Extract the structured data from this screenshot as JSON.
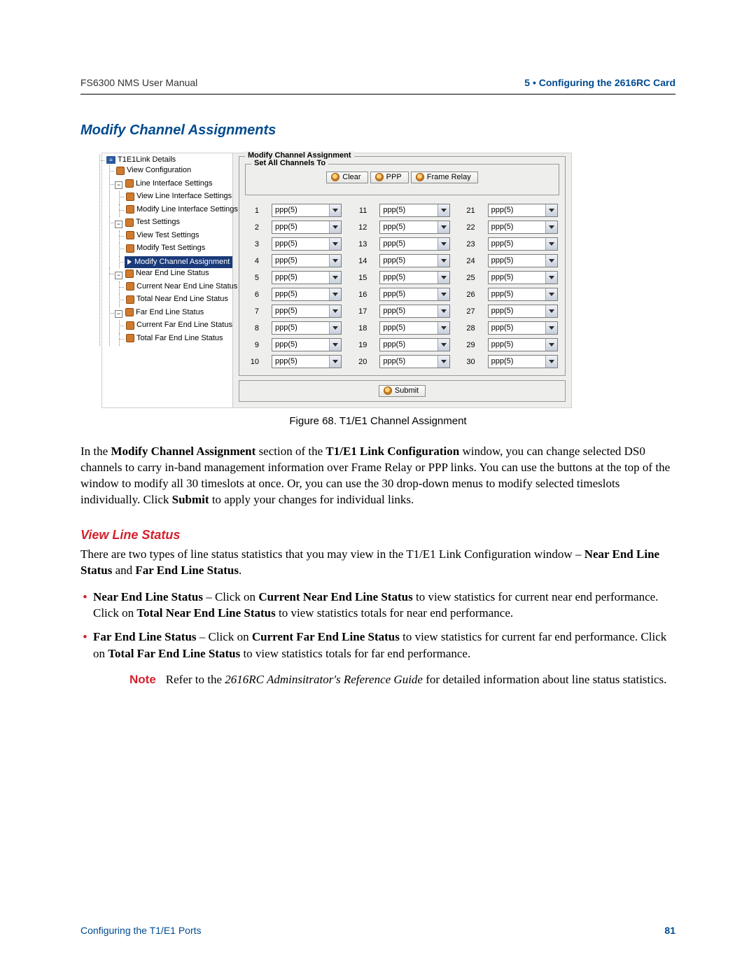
{
  "header": {
    "left": "FS6300 NMS User Manual",
    "right": "5 • Configuring the 2616RC Card"
  },
  "section_title": "Modify Channel Assignments",
  "tree": {
    "root": "T1E1Link Details",
    "items": {
      "view_config": "View Configuration",
      "line_if": "Line Interface Settings",
      "view_line_if": "View Line Interface Settings",
      "mod_line_if": "Modify Line Interface Settings",
      "test_settings": "Test Settings",
      "view_test": "View Test Settings",
      "mod_test": "Modify Test Settings",
      "mod_chan": "Modify Channel Assignment",
      "near": "Near End Line Status",
      "cur_near": "Current Near End Line Status",
      "tot_near": "Total Near End Line Status",
      "far": "Far End Line Status",
      "cur_far": "Current Far End Line Status",
      "tot_far": "Total Far End Line Status"
    }
  },
  "form": {
    "outer_legend": "Modify Channel Assignment",
    "inner_legend": "Set All Channels To",
    "buttons": {
      "clear": "Clear",
      "ppp": "PPP",
      "frame_relay": "Frame Relay",
      "submit": "Submit"
    },
    "channel_value": "ppp(5)",
    "channels": [
      1,
      2,
      3,
      4,
      5,
      6,
      7,
      8,
      9,
      10,
      11,
      12,
      13,
      14,
      15,
      16,
      17,
      18,
      19,
      20,
      21,
      22,
      23,
      24,
      25,
      26,
      27,
      28,
      29,
      30
    ]
  },
  "figure_caption": "Figure 68. T1/E1 Channel Assignment",
  "para1": {
    "s1a": "In the ",
    "b1": "Modify Channel Assignment",
    "s1b": " section of the ",
    "b2": "T1/E1 Link Configuration",
    "s1c": " window, you can change selected DS0 channels to carry in-band management information over Frame Relay or PPP links. You can use the buttons at the top of the window to modify all 30 timeslots at once. Or, you can use the 30 drop-down menus to modify selected timeslots individually. Click ",
    "b3": "Submit",
    "s1d": " to apply your changes for individual links."
  },
  "h3": "View Line Status",
  "para2": {
    "s1": "There are two types of line status statistics that you may view in the T1/E1 Link Configuration window – ",
    "b1": "Near End Line Status",
    "s2": " and ",
    "b2": "Far End Line Status",
    "s3": "."
  },
  "bul1": {
    "b1": "Near End Line Status",
    "s1": " – Click on ",
    "b2": "Current Near End Line Status",
    "s2": " to view statistics for current near end performance. Click on ",
    "b3": "Total Near End Line Status",
    "s3": " to view statistics totals for near end performance."
  },
  "bul2": {
    "b1": "Far End Line Status",
    "s1": " – Click on ",
    "b2": "Current Far End Line Status",
    "s2": " to view statistics for current far end performance. Click on ",
    "b3": "Total Far End Line Status",
    "s3": " to view statistics totals for far end performance."
  },
  "note": {
    "label": "Note",
    "s1": "Refer to the ",
    "i1": "2616RC Adminsitrator's Reference Guide",
    "s2": " for detailed information about line status statistics."
  },
  "footer": {
    "left": "Configuring the T1/E1 Ports",
    "right": "81"
  }
}
